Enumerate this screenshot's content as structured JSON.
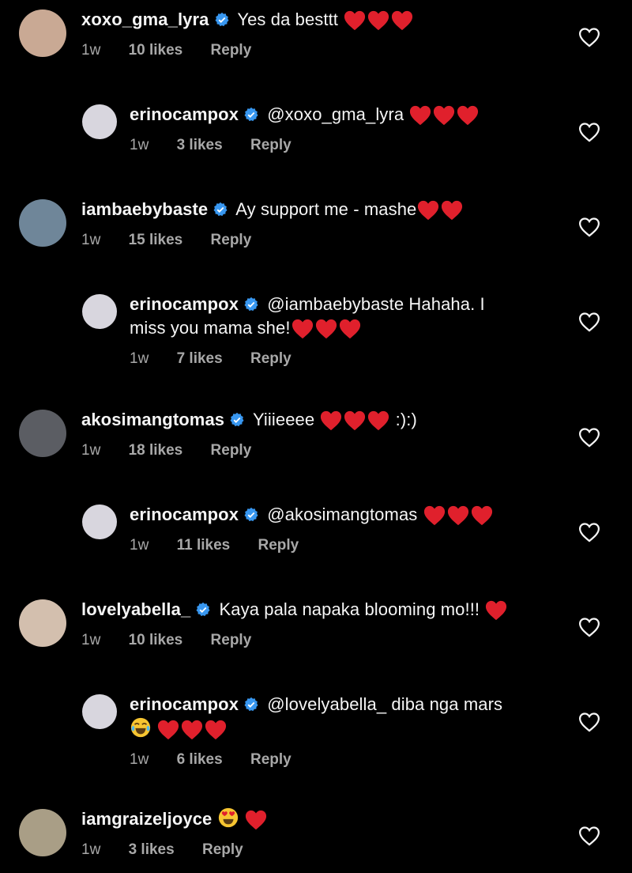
{
  "comments": [
    {
      "username": "xoxo_gma_lyra",
      "verified": true,
      "text": "Yes da besttt",
      "hearts": 3,
      "time": "1w",
      "likes": "10 likes",
      "reply": "Reply",
      "avatar_icon": "profile-photo-icon",
      "avatar_color": "#c9a994"
    },
    {
      "username": "erinocampox",
      "verified": true,
      "text": "@xoxo_gma_lyra",
      "hearts": 3,
      "time": "1w",
      "likes": "3 likes",
      "reply": "Reply",
      "avatar_icon": "profile-photo-icon",
      "avatar_color": "#d8d6de"
    },
    {
      "username": "iambaebybaste",
      "verified": true,
      "text": "Ay support me - mashe",
      "hearts": 2,
      "time": "1w",
      "likes": "15 likes",
      "reply": "Reply",
      "avatar_icon": "profile-photo-icon",
      "avatar_color": "#6f8699"
    },
    {
      "username": "erinocampox",
      "verified": true,
      "text": "@iambaebybaste Hahaha. I miss you mama she!",
      "hearts": 3,
      "time": "1w",
      "likes": "7 likes",
      "reply": "Reply",
      "avatar_icon": "profile-photo-icon",
      "avatar_color": "#d8d6de"
    },
    {
      "username": "akosimangtomas",
      "verified": true,
      "text": "Yiiieeee",
      "hearts": 3,
      "text_after": ":):)",
      "time": "1w",
      "likes": "18 likes",
      "reply": "Reply",
      "avatar_icon": "profile-photo-icon",
      "avatar_color": "#5b5d63"
    },
    {
      "username": "erinocampox",
      "verified": true,
      "text": "@akosimangtomas",
      "hearts": 3,
      "time": "1w",
      "likes": "11 likes",
      "reply": "Reply",
      "avatar_icon": "profile-photo-icon",
      "avatar_color": "#d8d6de"
    },
    {
      "username": "lovelyabella_",
      "verified": true,
      "text": "Kaya pala napaka blooming mo!!!",
      "hearts": 1,
      "time": "1w",
      "likes": "10 likes",
      "reply": "Reply",
      "avatar_icon": "profile-photo-icon",
      "avatar_color": "#d3bfae"
    },
    {
      "username": "erinocampox",
      "verified": true,
      "text": "@lovelyabella_ diba nga mars",
      "laugh_emoji": true,
      "hearts": 3,
      "time": "1w",
      "likes": "6 likes",
      "reply": "Reply",
      "avatar_icon": "profile-photo-icon",
      "avatar_color": "#d8d6de"
    },
    {
      "username": "iamgraizeljoyce",
      "verified": false,
      "text": "",
      "heart_eyes_emoji": true,
      "hearts": 1,
      "time": "1w",
      "likes": "3 likes",
      "reply": "Reply",
      "avatar_icon": "profile-photo-icon",
      "avatar_color": "#a99e86"
    }
  ],
  "icons": {
    "verified": "verified-badge-icon",
    "heart": "red-heart-emoji",
    "like": "heart-outline-icon"
  },
  "colors": {
    "background": "#000000",
    "text": "#f5f5f5",
    "meta": "#a8a8a8",
    "verified": "#3897f0",
    "heart": "#e0202c"
  }
}
